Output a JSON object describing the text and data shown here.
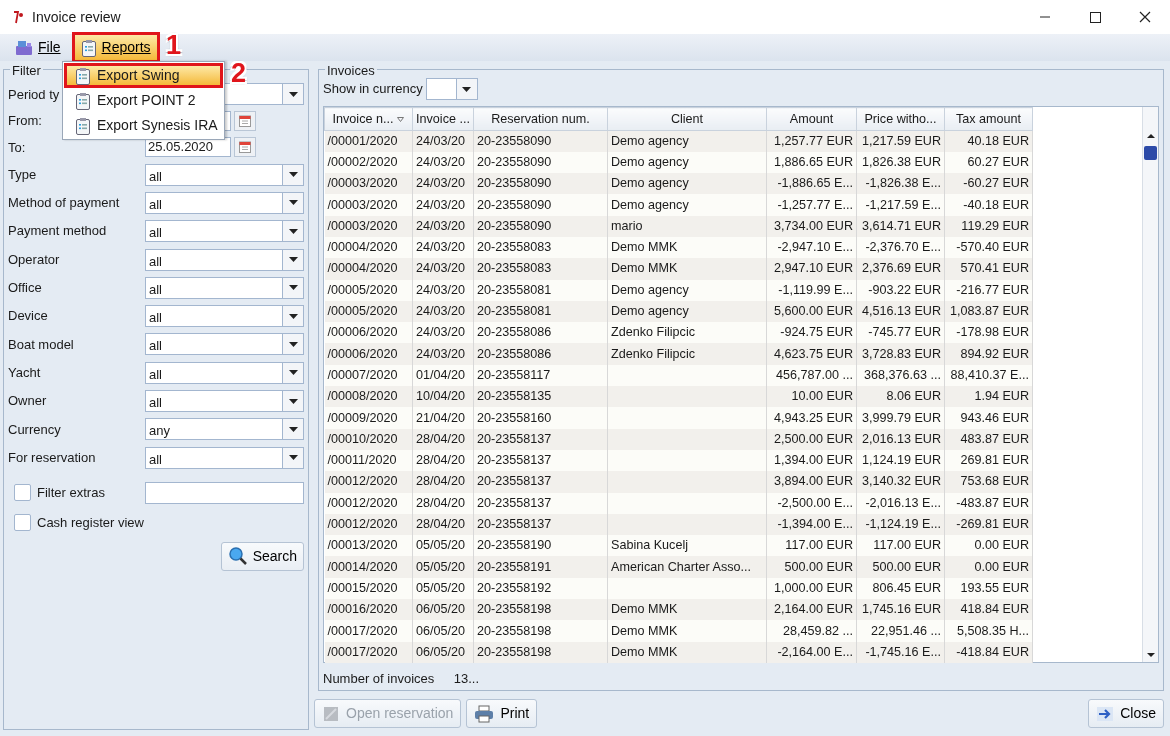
{
  "window": {
    "title": "Invoice review"
  },
  "menu_bar": [
    {
      "label": "File",
      "kind": "register",
      "selected": false
    },
    {
      "label": "Reports",
      "kind": "clipboard",
      "selected": true
    }
  ],
  "reports_menu": [
    {
      "label": "Export Swing",
      "selected": true
    },
    {
      "label": "Export POINT 2",
      "selected": false
    },
    {
      "label": "Export Synesis IRA",
      "selected": false
    }
  ],
  "callouts": [
    "1",
    "2"
  ],
  "filter": {
    "title": "Filter",
    "fields": [
      {
        "kind": "combo",
        "label": "Period ty"
      },
      {
        "kind": "date",
        "label": "From:"
      },
      {
        "kind": "date",
        "label": "To:",
        "value": "25.05.2020"
      },
      {
        "kind": "combo",
        "label": "Type",
        "value": "all"
      },
      {
        "kind": "combo",
        "label": "Method of payment",
        "value": "all"
      },
      {
        "kind": "combo",
        "label": "Payment method",
        "value": "all"
      },
      {
        "kind": "combo",
        "label": "Operator",
        "value": "all"
      },
      {
        "kind": "combo",
        "label": "Office",
        "value": "all"
      },
      {
        "kind": "combo",
        "label": "Device",
        "value": "all"
      },
      {
        "kind": "combo",
        "label": "Boat model",
        "value": "all"
      },
      {
        "kind": "combo",
        "label": "Yacht",
        "value": "all"
      },
      {
        "kind": "combo",
        "label": "Owner",
        "value": "all"
      },
      {
        "kind": "combo",
        "label": "Currency",
        "value": "any"
      },
      {
        "kind": "combo",
        "label": "For reservation",
        "value": "all"
      }
    ],
    "options": [
      {
        "kind": "with_text",
        "label": "Filter extras",
        "checked": false
      },
      {
        "kind": "plain",
        "label": "Cash register view",
        "checked": false
      }
    ],
    "search_button": "Search"
  },
  "invoices": {
    "title": "Invoices",
    "currency_label": "Show in currency",
    "columns": [
      {
        "label": "Invoice n...",
        "sorted": true,
        "kind": "text"
      },
      {
        "label": "Invoice ...",
        "sorted": false,
        "kind": "text"
      },
      {
        "label": "Reservation num.",
        "sorted": false,
        "kind": "text"
      },
      {
        "label": "Client",
        "sorted": false,
        "kind": "text"
      },
      {
        "label": "Amount",
        "sorted": false,
        "kind": "money"
      },
      {
        "label": "Price witho...",
        "sorted": false,
        "kind": "money"
      },
      {
        "label": "Tax amount",
        "sorted": false,
        "kind": "money"
      }
    ],
    "rows": [
      [
        "/00001/2020",
        "24/03/20",
        "20-23558090",
        "Demo agency",
        "1,257.77 EUR",
        "1,217.59 EUR",
        "40.18 EUR"
      ],
      [
        "/00002/2020",
        "24/03/20",
        "20-23558090",
        "Demo agency",
        "1,886.65 EUR",
        "1,826.38 EUR",
        "60.27 EUR"
      ],
      [
        "/00003/2020",
        "24/03/20",
        "20-23558090",
        "Demo agency",
        "-1,886.65 E...",
        "-1,826.38 E...",
        "-60.27 EUR"
      ],
      [
        "/00003/2020",
        "24/03/20",
        "20-23558090",
        "Demo agency",
        "-1,257.77 E...",
        "-1,217.59 E...",
        "-40.18 EUR"
      ],
      [
        "/00003/2020",
        "24/03/20",
        "20-23558090",
        "mario",
        "3,734.00 EUR",
        "3,614.71 EUR",
        "119.29 EUR"
      ],
      [
        "/00004/2020",
        "24/03/20",
        "20-23558083",
        "Demo MMK",
        "-2,947.10 E...",
        "-2,376.70 E...",
        "-570.40 EUR"
      ],
      [
        "/00004/2020",
        "24/03/20",
        "20-23558083",
        "Demo MMK",
        "2,947.10 EUR",
        "2,376.69 EUR",
        "570.41 EUR"
      ],
      [
        "/00005/2020",
        "24/03/20",
        "20-23558081",
        "Demo agency",
        "-1,119.99 E...",
        "-903.22 EUR",
        "-216.77 EUR"
      ],
      [
        "/00005/2020",
        "24/03/20",
        "20-23558081",
        "Demo agency",
        "5,600.00 EUR",
        "4,516.13 EUR",
        "1,083.87 EUR"
      ],
      [
        "/00006/2020",
        "24/03/20",
        "20-23558086",
        "Zdenko Filipcic",
        "-924.75 EUR",
        "-745.77 EUR",
        "-178.98 EUR"
      ],
      [
        "/00006/2020",
        "24/03/20",
        "20-23558086",
        "Zdenko Filipcic",
        "4,623.75 EUR",
        "3,728.83 EUR",
        "894.92 EUR"
      ],
      [
        "/00007/2020",
        "01/04/20",
        "20-23558117",
        null,
        "456,787.00 ...",
        "368,376.63 ...",
        "88,410.37 E..."
      ],
      [
        "/00008/2020",
        "10/04/20",
        "20-23558135",
        null,
        "10.00 EUR",
        "8.06 EUR",
        "1.94 EUR"
      ],
      [
        "/00009/2020",
        "21/04/20",
        "20-23558160",
        null,
        "4,943.25 EUR",
        "3,999.79 EUR",
        "943.46 EUR"
      ],
      [
        "/00010/2020",
        "28/04/20",
        "20-23558137",
        null,
        "2,500.00 EUR",
        "2,016.13 EUR",
        "483.87 EUR"
      ],
      [
        "/00011/2020",
        "28/04/20",
        "20-23558137",
        null,
        "1,394.00 EUR",
        "1,124.19 EUR",
        "269.81 EUR"
      ],
      [
        "/00012/2020",
        "28/04/20",
        "20-23558137",
        null,
        "3,894.00 EUR",
        "3,140.32 EUR",
        "753.68 EUR"
      ],
      [
        "/00012/2020",
        "28/04/20",
        "20-23558137",
        null,
        "-2,500.00 E...",
        "-2,016.13 E...",
        "-483.87 EUR"
      ],
      [
        "/00012/2020",
        "28/04/20",
        "20-23558137",
        null,
        "-1,394.00 E...",
        "-1,124.19 E...",
        "-269.81 EUR"
      ],
      [
        "/00013/2020",
        "05/05/20",
        "20-23558190",
        "Sabina Kucelj",
        "117.00 EUR",
        "117.00 EUR",
        "0.00 EUR"
      ],
      [
        "/00014/2020",
        "05/05/20",
        "20-23558191",
        "American Charter Asso...",
        "500.00 EUR",
        "500.00 EUR",
        "0.00 EUR"
      ],
      [
        "/00015/2020",
        "05/05/20",
        "20-23558192",
        null,
        "1,000.00 EUR",
        "806.45 EUR",
        "193.55 EUR"
      ],
      [
        "/00016/2020",
        "06/05/20",
        "20-23558198",
        "Demo MMK",
        "2,164.00 EUR",
        "1,745.16 EUR",
        "418.84 EUR"
      ],
      [
        "/00017/2020",
        "06/05/20",
        "20-23558198",
        "Demo MMK",
        "28,459.82 ...",
        "22,951.46 ...",
        "5,508.35 H..."
      ],
      [
        "/00017/2020",
        "06/05/20",
        "20-23558198",
        "Demo MMK",
        "-2,164.00 E...",
        "-1,745.16 E...",
        "-418.84 EUR"
      ]
    ],
    "count_label": "Number of invoices",
    "count_value": "13..."
  },
  "buttons": [
    {
      "kind": "open",
      "label": "Open reservation",
      "disabled": true
    },
    {
      "kind": "print",
      "label": "Print",
      "disabled": false
    },
    {
      "kind": "close",
      "label": "Close",
      "disabled": false
    }
  ]
}
